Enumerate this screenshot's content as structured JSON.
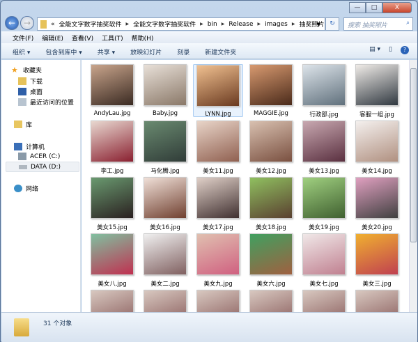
{
  "window": {
    "minimize": "—",
    "maximize": "□",
    "close": "X"
  },
  "address": {
    "overflow": "«",
    "crumbs": [
      "全能文字数字抽奖软件",
      "全能文字数字抽奖软件",
      "bin",
      "Release",
      "images",
      "抽奖照片"
    ]
  },
  "search": {
    "placeholder": "搜索 抽奖照片"
  },
  "menu": [
    "文件(F)",
    "编辑(E)",
    "查看(V)",
    "工具(T)",
    "帮助(H)"
  ],
  "toolbar": [
    "组织 ▾",
    "包含到库中 ▾",
    "共享 ▾",
    "放映幻灯片",
    "刻录",
    "新建文件夹"
  ],
  "sidebar": {
    "favorites": "收藏夹",
    "downloads": "下载",
    "desktop": "桌面",
    "recent": "最近访问的位置",
    "library": "库",
    "computer": "计算机",
    "drive_c": "ACER (C:)",
    "drive_d": "DATA (D:)",
    "network": "网络"
  },
  "files": [
    "AndyLau.jpg",
    "Baby.jpg",
    "LYNN.jpg",
    "MAGGIE.jpg",
    "行政部.jpg",
    "客服一组.jpg",
    "李工.jpg",
    "马化腾.jpg",
    "美女11.jpg",
    "美女12.jpg",
    "美女13.jpg",
    "美女14.jpg",
    "美女15.jpg",
    "美女16.jpg",
    "美女17.jpg",
    "美女18.jpg",
    "美女19.jpg",
    "美女20.jpg",
    "美女八.jpg",
    "美女二.jpg",
    "美女九.jpg",
    "美女六.jpg",
    "美女七.jpg",
    "美女三.jpg"
  ],
  "status": {
    "count": "31 个对象"
  }
}
